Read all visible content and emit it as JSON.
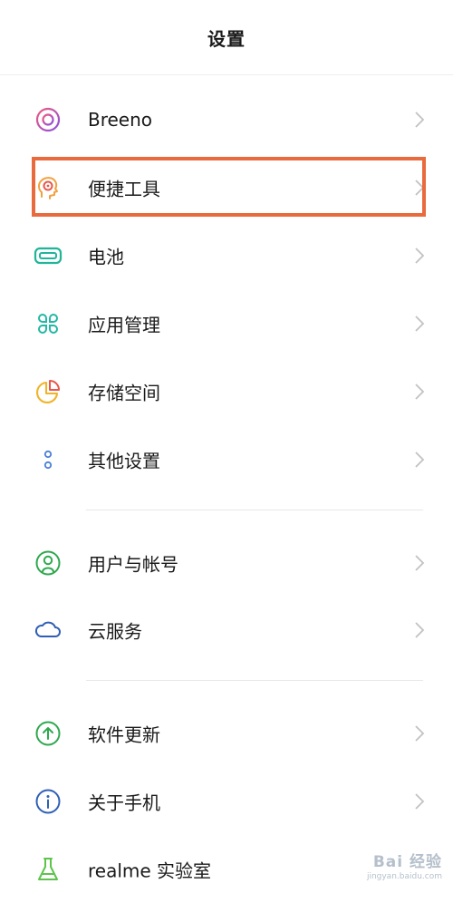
{
  "header": {
    "title": "设置"
  },
  "items": [
    {
      "label": "Breeno",
      "icon": "breeno-icon"
    },
    {
      "label": "便捷工具",
      "icon": "convenience-tools-icon"
    },
    {
      "label": "电池",
      "icon": "battery-icon"
    },
    {
      "label": "应用管理",
      "icon": "app-management-icon"
    },
    {
      "label": "存储空间",
      "icon": "storage-icon"
    },
    {
      "label": "其他设置",
      "icon": "other-settings-icon"
    },
    {
      "label": "用户与帐号",
      "icon": "user-account-icon"
    },
    {
      "label": "云服务",
      "icon": "cloud-icon"
    },
    {
      "label": "软件更新",
      "icon": "software-update-icon"
    },
    {
      "label": "关于手机",
      "icon": "about-phone-icon"
    },
    {
      "label": "realme 实验室",
      "icon": "realme-lab-icon"
    }
  ],
  "highlight": {
    "item": "便捷工具",
    "color": "#e96a3c"
  },
  "watermark": {
    "text": "Bai 经验",
    "sub": "jingyan.baidu.com"
  }
}
